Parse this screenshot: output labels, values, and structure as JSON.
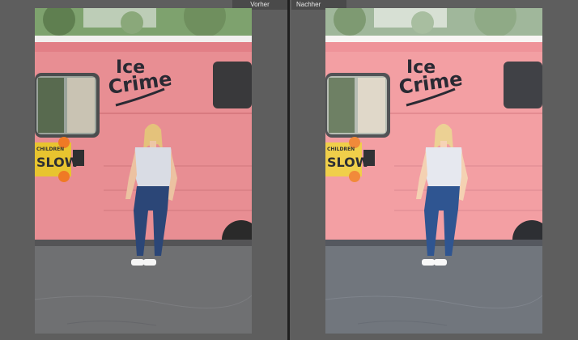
{
  "labels": {
    "before": "Vorher",
    "after": "Nachher"
  },
  "truck_text": {
    "line1": "Ice",
    "line2": "Crime",
    "sign_top": "CHILDREN",
    "sign_main": "SLOW"
  },
  "colors": {
    "background": "#5e5e5e",
    "divider": "#1f1f1f",
    "truck_before": "#e88e93",
    "truck_after": "#f39fa3",
    "road_before": "#6f7072",
    "road_after": "#71767d"
  }
}
